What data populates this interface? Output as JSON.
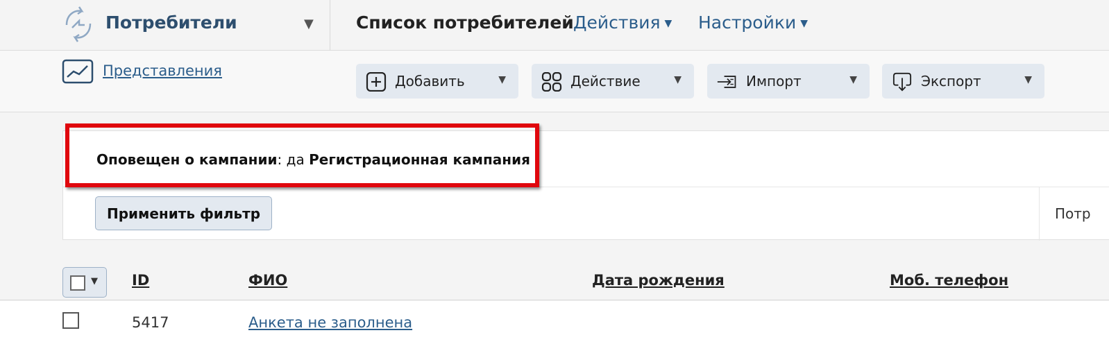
{
  "header": {
    "app_title": "Потребители",
    "nav": {
      "list": "Список потребителей",
      "actions": "Действия",
      "settings": "Настройки"
    }
  },
  "toolbar": {
    "views_link": "Представления",
    "buttons": {
      "add": "Добавить",
      "action": "Действие",
      "import": "Импорт",
      "export": "Экспорт"
    }
  },
  "filter": {
    "label": "Оповещен о кампании",
    "separator": ":",
    "value": " да ",
    "campaign": "Регистрационная кампания",
    "apply_label": "Применить фильтр",
    "side_text": "Потр"
  },
  "table": {
    "columns": {
      "id": "ID",
      "fio": "ФИО",
      "dob": "Дата рождения",
      "phone": "Моб. телефон"
    },
    "rows": [
      {
        "id": "5417",
        "fio": "Анкета не заполнена"
      }
    ]
  },
  "colors": {
    "accent": "#2b5d8b",
    "highlight": "#e0070d",
    "button_bg": "#e3e9f0"
  }
}
